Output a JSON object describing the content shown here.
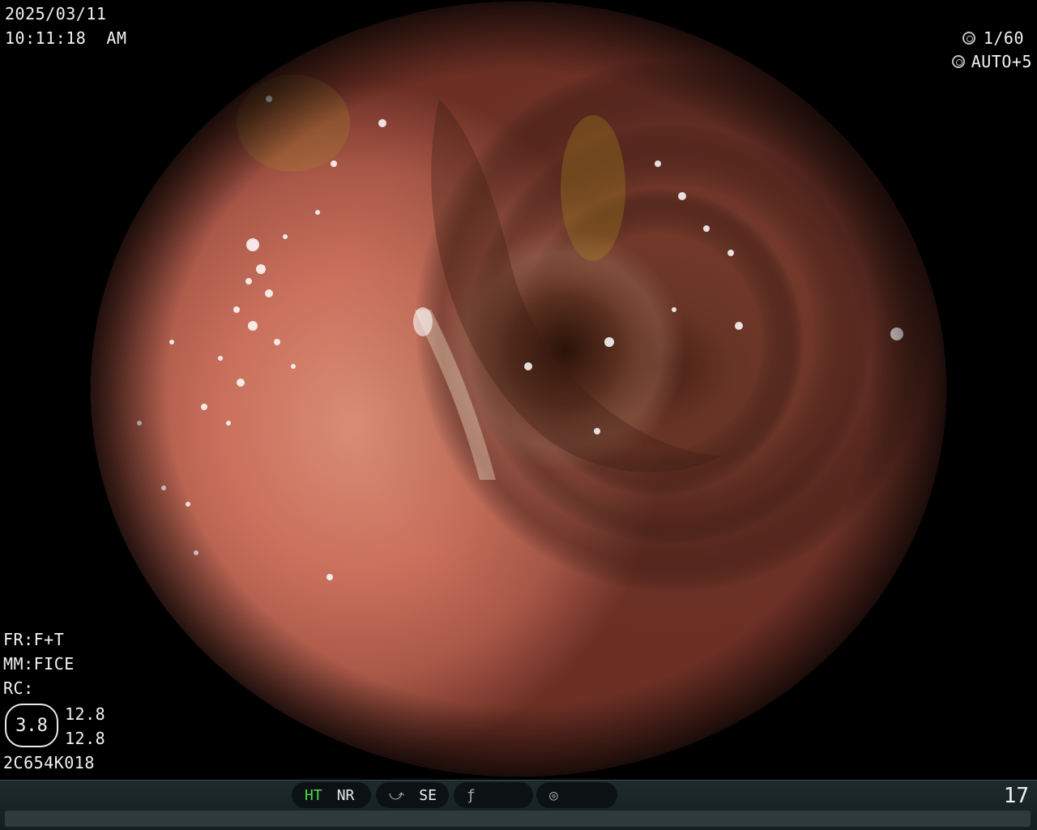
{
  "header": {
    "date": "2025/03/11",
    "time": "10:11:18  AM"
  },
  "exposure": {
    "shutter": "1/60",
    "mode": "AUTO+5",
    "shutter_icon": "aperture-icon",
    "mode_icon": "iris-icon"
  },
  "settings": {
    "fr": "FR:F+T",
    "mm": "MM:FICE",
    "rc": "RC:",
    "zoom_value": "3.8",
    "value_a": "12.8",
    "value_b": "12.8",
    "serial": "2C654K018"
  },
  "status_bar": {
    "ht": "HT",
    "nr": "NR",
    "se": "SE",
    "frame_number": "17",
    "se_icon": "tone-curve-icon",
    "filter_icon": "slash-f-icon",
    "mode_icon": "waveform-circle-icon"
  },
  "colors": {
    "ht_active": "#4cd94c",
    "text": "#f2f2f2",
    "bar": "#1d2a2c"
  }
}
